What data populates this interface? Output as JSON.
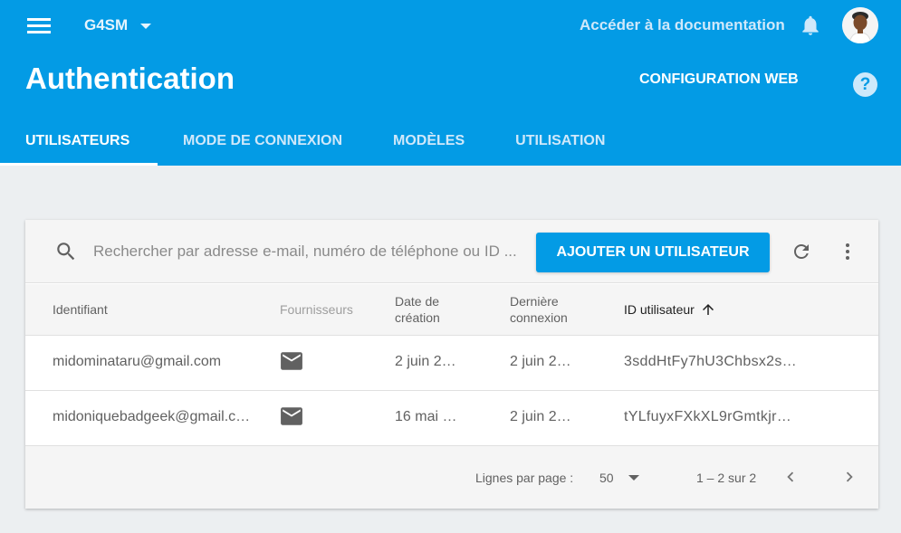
{
  "header": {
    "project_name": "G4SM",
    "docs_link": "Accéder à la documentation",
    "page_title": "Authentication",
    "config_button": "CONFIGURATION WEB",
    "help_symbol": "?",
    "tabs": [
      {
        "label": "UTILISATEURS",
        "active": true
      },
      {
        "label": "MODE DE CONNEXION",
        "active": false
      },
      {
        "label": "MODÈLES",
        "active": false
      },
      {
        "label": "UTILISATION",
        "active": false
      }
    ],
    "accent_color": "#039be5"
  },
  "toolbar": {
    "search_placeholder": "Rechercher par adresse e-mail, numéro de téléphone ou ID ...",
    "add_user_button": "AJOUTER UN UTILISATEUR"
  },
  "table": {
    "columns": {
      "identifier": "Identifiant",
      "providers": "Fournisseurs",
      "created_line1": "Date de",
      "created_line2": "création",
      "last_login_line1": "Dernière",
      "last_login_line2": "connexion",
      "user_id": "ID utilisateur"
    },
    "rows": [
      {
        "identifier": "midominataru@gmail.com",
        "provider_icon": "mail-icon",
        "created": "2 juin 2…",
        "last_login": "2 juin 2…",
        "user_id": "3sddHtFy7hU3Chbsx2s…"
      },
      {
        "identifier": "midoniquebadgeek@gmail.c…",
        "provider_icon": "mail-icon",
        "created": "16 mai …",
        "last_login": "2 juin 2…",
        "user_id": "tYLfuyxFXkXL9rGmtkjr…"
      }
    ]
  },
  "footer": {
    "rows_per_page_label": "Lignes par page :",
    "rows_per_page_value": "50",
    "range_text": "1 – 2 sur 2"
  }
}
